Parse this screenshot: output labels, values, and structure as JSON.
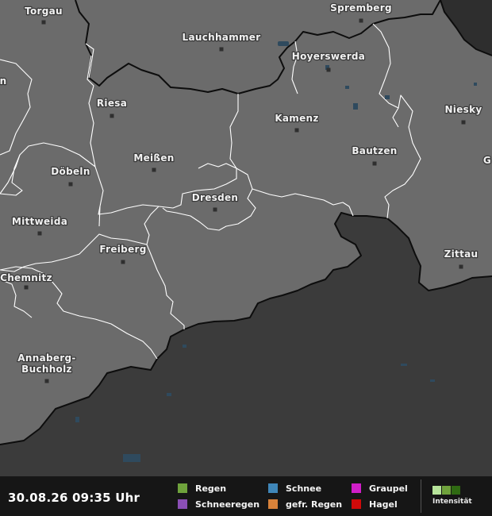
{
  "map": {
    "colors": {
      "land_inside": "#6b6b6b",
      "land_outside": "#3b3b3b",
      "dark_corner": "#2e2e2e",
      "border_line": "#ffffff",
      "country_line": "#0d0d0d",
      "water": "#2f4a5e"
    },
    "cities": [
      {
        "id": "torgau",
        "name": "Torgau"
      },
      {
        "id": "spremberg",
        "name": "Spremberg"
      },
      {
        "id": "lauchhammer",
        "name": "Lauchhammer"
      },
      {
        "id": "hoyerswerda",
        "name": "Hoyerswerda"
      },
      {
        "id": "riesa",
        "name": "Riesa"
      },
      {
        "id": "niesky",
        "name": "Niesky"
      },
      {
        "id": "kamenz",
        "name": "Kamenz"
      },
      {
        "id": "bautzen",
        "name": "Bautzen"
      },
      {
        "id": "meissen",
        "name": "Meißen"
      },
      {
        "id": "doebeln",
        "name": "Döbeln"
      },
      {
        "id": "dresden",
        "name": "Dresden"
      },
      {
        "id": "mittweida",
        "name": "Mittweida"
      },
      {
        "id": "freiberg",
        "name": "Freiberg"
      },
      {
        "id": "zittau",
        "name": "Zittau"
      },
      {
        "id": "chemnitz",
        "name": "Chemnitz"
      },
      {
        "id": "annaberg1",
        "name": "Annaberg-"
      },
      {
        "id": "annaberg2",
        "name": "Buchholz"
      },
      {
        "id": "edge_right",
        "name": "G"
      },
      {
        "id": "edge_left",
        "name": "n"
      }
    ]
  },
  "footer": {
    "timestamp": "30.08.26 09:35 Uhr",
    "legend": [
      {
        "label": "Regen",
        "color": "#6fa23c"
      },
      {
        "label": "Schneeregen",
        "color": "#8b4fb5"
      },
      {
        "label": "Schnee",
        "color": "#3f86b8"
      },
      {
        "label": "gefr. Regen",
        "color": "#d8823a"
      },
      {
        "label": "Graupel",
        "color": "#d01ec8"
      },
      {
        "label": "Hagel",
        "color": "#d00a0a"
      }
    ],
    "intensity": {
      "label": "Intensität",
      "colors": [
        "#b6e39a",
        "#6fa23c",
        "#2f6a12"
      ]
    }
  }
}
